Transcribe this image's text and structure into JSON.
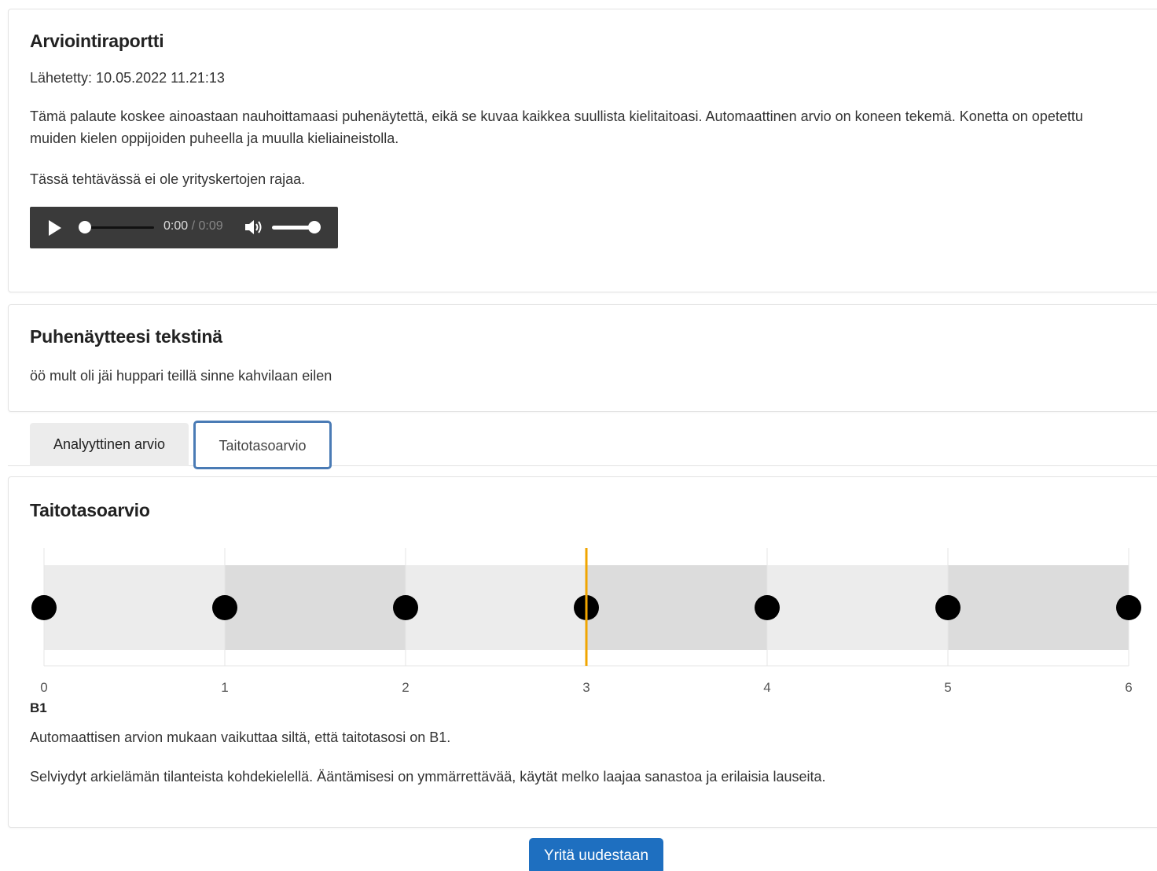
{
  "report": {
    "title": "Arviointiraportti",
    "sent": "Lähetetty: 10.05.2022 11.21:13",
    "intro": "Tämä palaute koskee ainoastaan nauhoittamaasi puhenäytettä, eikä se kuvaa kaikkea suullista kielitaitoasi. Automaattinen arvio on koneen tekemä. Konetta on opetettu muiden kielen oppijoiden puheella ja muulla kieliaineistolla.",
    "attempts": "Tässä tehtävässä ei ole yrityskertojen rajaa.",
    "audio": {
      "current_time": "0:00",
      "separator": " / ",
      "duration": "0:09",
      "progress_fraction": 0,
      "volume_fraction": 1.0,
      "play_icon": "play-icon",
      "volume_icon": "volume-icon"
    }
  },
  "transcript": {
    "title": "Puhenäytteesi tekstinä",
    "text": "öö mult oli jäi huppari teillä sinne kahvilaan eilen"
  },
  "tabs": [
    {
      "label": "Analyyttinen arvio",
      "active": false
    },
    {
      "label": "Taitotasoarvio",
      "active": true
    }
  ],
  "level": {
    "title": "Taitotasoarvio",
    "code": "B1",
    "summary": "Automaattisen arvion mukaan vaikuttaa siltä, että taitotasosi on B1.",
    "description": "Selviydyt arkielämän tilanteista kohdekielellä. Ääntämisesi on ymmärrettävää, käytät melko laajaa sanastoa ja erilaisia lauseita."
  },
  "chart_data": {
    "type": "scatter",
    "x": [
      0,
      1,
      2,
      3,
      4,
      5,
      6
    ],
    "xlim": [
      0,
      6
    ],
    "tick_labels": [
      "0",
      "1",
      "2",
      "3",
      "4",
      "5",
      "6"
    ],
    "marker_value": 3,
    "marker_color": "#f0a500",
    "band_colors": [
      "#ececec",
      "#dcdcdc"
    ],
    "point_color": "#000000",
    "grid": true
  },
  "retry_label": "Yritä uudestaan"
}
